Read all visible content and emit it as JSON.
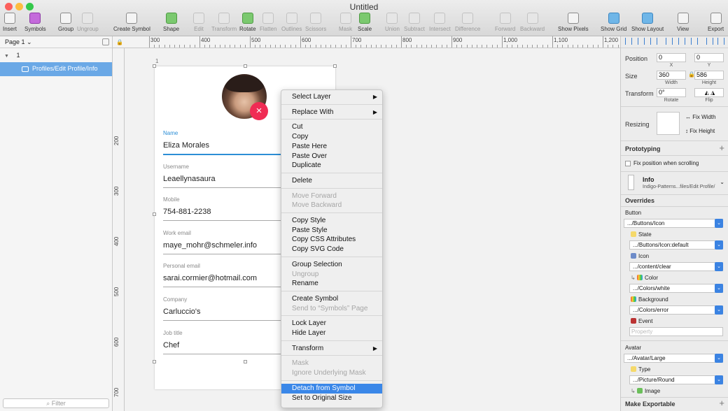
{
  "window": {
    "title": "Untitled"
  },
  "toolbar": [
    {
      "label": "Insert",
      "icon": "plus-icon",
      "enabled": true
    },
    {
      "label": "Symbols",
      "icon": "symbols-icon",
      "enabled": true
    },
    {
      "label": "Group",
      "icon": "group-icon",
      "enabled": true
    },
    {
      "label": "Ungroup",
      "icon": "ungroup-icon",
      "enabled": false
    },
    {
      "label": "Create Symbol",
      "icon": "create-symbol-icon",
      "enabled": true
    },
    {
      "label": "Shape",
      "icon": "shape-icon",
      "enabled": true
    },
    {
      "label": "Edit",
      "icon": "edit-icon",
      "enabled": false
    },
    {
      "label": "Transform",
      "icon": "transform-icon",
      "enabled": false
    },
    {
      "label": "Rotate",
      "icon": "rotate-icon",
      "enabled": true
    },
    {
      "label": "Flatten",
      "icon": "flatten-icon",
      "enabled": false
    },
    {
      "label": "Outlines",
      "icon": "outlines-icon",
      "enabled": false
    },
    {
      "label": "Scissors",
      "icon": "scissors-icon",
      "enabled": false
    },
    {
      "label": "Mask",
      "icon": "mask-icon",
      "enabled": false
    },
    {
      "label": "Scale",
      "icon": "scale-icon",
      "enabled": true
    },
    {
      "label": "Union",
      "icon": "union-icon",
      "enabled": false
    },
    {
      "label": "Subtract",
      "icon": "subtract-icon",
      "enabled": false
    },
    {
      "label": "Intersect",
      "icon": "intersect-icon",
      "enabled": false
    },
    {
      "label": "Difference",
      "icon": "difference-icon",
      "enabled": false
    },
    {
      "label": "Forward",
      "icon": "forward-icon",
      "enabled": false
    },
    {
      "label": "Backward",
      "icon": "backward-icon",
      "enabled": false
    },
    {
      "label": "Show Pixels",
      "icon": "show-pixels-icon",
      "enabled": true
    },
    {
      "label": "Show Grid",
      "icon": "show-grid-icon",
      "enabled": true
    },
    {
      "label": "Show Layout",
      "icon": "show-layout-icon",
      "enabled": true
    },
    {
      "label": "View",
      "icon": "view-icon",
      "enabled": true
    },
    {
      "label": "Export",
      "icon": "export-icon",
      "enabled": true
    }
  ],
  "layers": {
    "page": "Page 1 ⌄",
    "artboard_num": "1",
    "selected_layer": "Profiles/Edit Profile/Info",
    "filter_placeholder": "Filter"
  },
  "ruler": {
    "top": [
      "300",
      "400",
      "500",
      "600",
      "700",
      "800",
      "900",
      "1,000",
      "1,100",
      "1,200"
    ],
    "left": [
      "200",
      "300",
      "400",
      "500",
      "600",
      "700"
    ]
  },
  "artboard": {
    "label": "1",
    "fields": [
      {
        "label": "Name",
        "value": "Eliza Morales",
        "active": true
      },
      {
        "label": "Username",
        "value": "Leaellynasaura",
        "active": false
      },
      {
        "label": "Mobile",
        "value": "754-881-2238",
        "active": false
      },
      {
        "label": "Work email",
        "value": "maye_mohr@schmeler.info",
        "active": false
      },
      {
        "label": "Personal email",
        "value": "sarai.cormier@hotmail.com",
        "active": false
      },
      {
        "label": "Company",
        "value": "Carluccio's",
        "active": false
      },
      {
        "label": "Job title",
        "value": "Chef",
        "active": false
      }
    ],
    "clear_icon": "×",
    "accent_color": "#2c8ed6",
    "error_color": "#f02c54"
  },
  "context_menu": {
    "items": [
      {
        "label": "Select Layer",
        "submenu": true
      },
      {
        "sep": true
      },
      {
        "label": "Replace With",
        "submenu": true
      },
      {
        "sep": true
      },
      {
        "label": "Cut"
      },
      {
        "label": "Copy"
      },
      {
        "label": "Paste Here"
      },
      {
        "label": "Paste Over"
      },
      {
        "label": "Duplicate"
      },
      {
        "sep": true
      },
      {
        "label": "Delete"
      },
      {
        "sep": true
      },
      {
        "label": "Move Forward",
        "disabled": true
      },
      {
        "label": "Move Backward",
        "disabled": true
      },
      {
        "sep": true
      },
      {
        "label": "Copy Style"
      },
      {
        "label": "Paste Style"
      },
      {
        "label": "Copy CSS Attributes"
      },
      {
        "label": "Copy SVG Code"
      },
      {
        "sep": true
      },
      {
        "label": "Group Selection"
      },
      {
        "label": "Ungroup",
        "disabled": true
      },
      {
        "label": "Rename"
      },
      {
        "sep": true
      },
      {
        "label": "Create Symbol"
      },
      {
        "label": "Send to “Symbols” Page",
        "disabled": true
      },
      {
        "sep": true
      },
      {
        "label": "Lock Layer"
      },
      {
        "label": "Hide Layer"
      },
      {
        "sep": true
      },
      {
        "label": "Transform",
        "submenu": true
      },
      {
        "sep": true
      },
      {
        "label": "Mask",
        "disabled": true
      },
      {
        "label": "Ignore Underlying Mask",
        "disabled": true
      },
      {
        "sep": true
      },
      {
        "label": "Detach from Symbol",
        "highlighted": true
      },
      {
        "label": "Set to Original Size"
      }
    ]
  },
  "inspector": {
    "position_label": "Position",
    "x_value": "0",
    "y_value": "0",
    "x_label": "X",
    "y_label": "Y",
    "size_label": "Size",
    "width_value": "360",
    "height_value": "586",
    "width_label": "Width",
    "height_label": "Height",
    "transform_label": "Transform",
    "rotate_value": "0°",
    "rotate_label": "Rotate",
    "flip_label": "Flip",
    "resizing_label": "Resizing",
    "fix_width": "Fix Width",
    "fix_height": "Fix Height",
    "prototyping": "Prototyping",
    "fix_position": "Fix position when scrolling",
    "symbol_name": "Info",
    "symbol_path": "Indigo-Patterns...files/Edit Profile/",
    "overrides": "Overrides",
    "button_label": "Button",
    "button_value": ".../Buttons/Icon",
    "state_label": "State",
    "state_value": ".../Buttons/Icon:default",
    "icon_label": "Icon",
    "icon_value": ".../content/clear",
    "color_label": "Color",
    "color_value": ".../Colors/white",
    "background_label": "Background",
    "background_value": ".../Colors/error",
    "event_label": "Event",
    "property_placeholder": "Property",
    "avatar_label": "Avatar",
    "avatar_value": ".../Avatar/Large",
    "type_label": "Type",
    "type_value": ".../Picture/Round",
    "image_label": "Image",
    "make_exportable": "Make Exportable"
  }
}
